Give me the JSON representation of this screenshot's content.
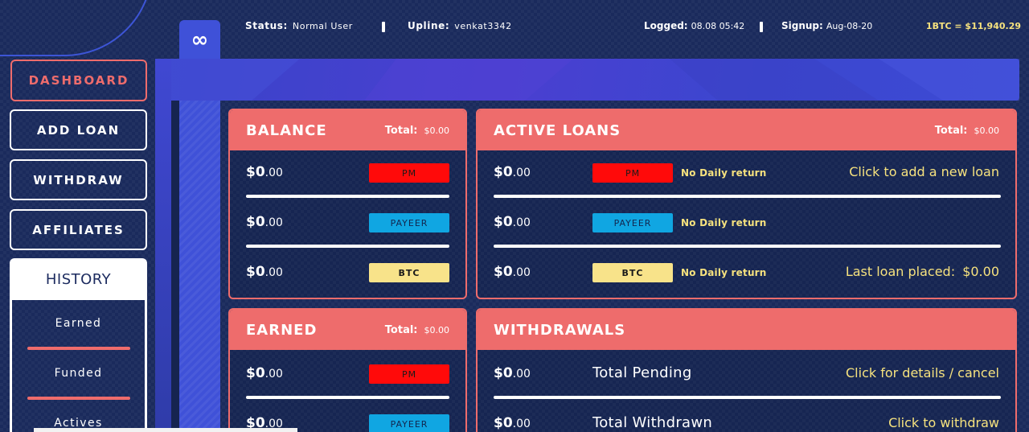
{
  "topbar": {
    "logo_symbol": "∞",
    "status_label": "Status:",
    "status_value": "Normal User",
    "upline_label": "Upline:",
    "upline_value": "venkat3342",
    "logged_label": "Logged:",
    "logged_value": "08.08 05:42",
    "signup_label": "Signup:",
    "signup_value": "Aug-08-20",
    "btc_rate": "1BTC = $11,940.29"
  },
  "sidebar": {
    "items": [
      {
        "label": "DASHBOARD",
        "active": true
      },
      {
        "label": "ADD LOAN"
      },
      {
        "label": "WITHDRAW"
      },
      {
        "label": "AFFILIATES"
      }
    ],
    "history": {
      "title": "HISTORY",
      "links": [
        "Earned",
        "Funded",
        "Actives"
      ]
    }
  },
  "balance": {
    "title": "BALANCE",
    "total_label": "Total:",
    "total_value": "$0.00",
    "rows": [
      {
        "dollars": "$0",
        "cents": ".00",
        "badge": "PM"
      },
      {
        "dollars": "$0",
        "cents": ".00",
        "badge": "PAYEER"
      },
      {
        "dollars": "$0",
        "cents": ".00",
        "badge": "BTC"
      }
    ]
  },
  "active_loans": {
    "title": "ACTIVE LOANS",
    "total_label": "Total:",
    "total_value": "$0.00",
    "rows": [
      {
        "dollars": "$0",
        "cents": ".00",
        "badge": "PM",
        "note": "No Daily return"
      },
      {
        "dollars": "$0",
        "cents": ".00",
        "badge": "PAYEER",
        "note": "No Daily return"
      },
      {
        "dollars": "$0",
        "cents": ".00",
        "badge": "BTC",
        "note": "No Daily return"
      }
    ],
    "add_loan_link": "Click to add a new loan",
    "last_loan_label": "Last loan placed:",
    "last_loan_value": "$0.00"
  },
  "earned": {
    "title": "EARNED",
    "total_label": "Total:",
    "total_value": "$0.00",
    "rows": [
      {
        "dollars": "$0",
        "cents": ".00",
        "badge": "PM"
      },
      {
        "dollars": "$0",
        "cents": ".00",
        "badge": "PAYEER"
      }
    ]
  },
  "withdrawals": {
    "title": "WITHDRAWALS",
    "rows": [
      {
        "dollars": "$0",
        "cents": ".00",
        "label": "Total Pending",
        "link": "Click for details / cancel"
      },
      {
        "dollars": "$0",
        "cents": ".00",
        "label": "Total Withdrawn",
        "link": "Click to withdraw"
      }
    ]
  },
  "colors": {
    "background": "#1a2a5c",
    "accent_coral": "#ee6c6c",
    "accent_blue": "#3f51d8",
    "highlight_yellow": "#f6e27e",
    "pm_red": "#ff0a0a",
    "payeer_blue": "#10a6e2",
    "btc_yellow": "#f8e38a"
  }
}
